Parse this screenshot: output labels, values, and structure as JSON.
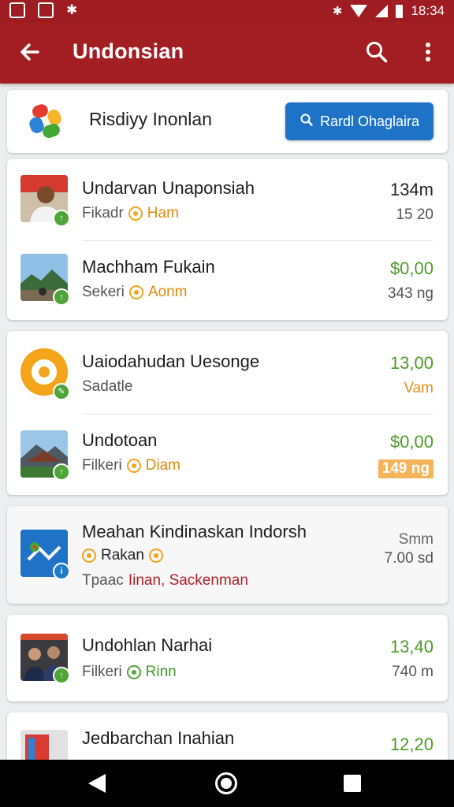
{
  "status_bar": {
    "time": "18:34"
  },
  "app_bar": {
    "title": "Undonsian"
  },
  "header": {
    "title": "Risdiyy Inonlan",
    "button_label": "Rardl Ohaglaira"
  },
  "groups": [
    {
      "items": [
        {
          "name": "Undarvan Unaponsiah",
          "sub_label": "Fikadr",
          "tag": "Ham",
          "amount": "134m",
          "meta": "15 20"
        },
        {
          "name": "Machham Fukain",
          "sub_label": "Sekeri",
          "tag": "Aonm",
          "amount": "$0,00",
          "meta": "343 ng"
        }
      ]
    },
    {
      "items": [
        {
          "name": "Uaiodahudan Uesonge",
          "sub_label": "Sadatle",
          "amount": "13,00",
          "meta": "Vam"
        },
        {
          "name": "Undotoan",
          "sub_label": "Filkeri",
          "tag": "Diam",
          "amount": "$0,00",
          "meta": "149 ng"
        }
      ]
    },
    {
      "items": [
        {
          "name": "Meahan Kindinaskan Indorsh",
          "sub_label": "Rakan",
          "sub_line2_prefix": "Tpaac",
          "sub_line2_link": "Iinan, Sackenman",
          "amount": "Smm",
          "meta": "7.00 sd"
        }
      ]
    },
    {
      "items": [
        {
          "name": "Undohlan Narhai",
          "sub_label": "Filkeri",
          "tag": "Rinn",
          "amount": "13,40",
          "meta": "740 m"
        }
      ]
    },
    {
      "items": [
        {
          "name": "Jedbarchan Inahian",
          "amount": "12,20"
        }
      ]
    }
  ],
  "icons": {
    "back": "arrow-left-icon",
    "search": "search-icon",
    "more": "more-vert-icon",
    "logo": "app-logo-icon",
    "nav_back": "nav-back-icon",
    "nav_home": "nav-home-icon",
    "nav_recent": "nav-recent-icon"
  },
  "colors": {
    "primary": "#a31e23",
    "accent_blue": "#1f73c7",
    "green": "#4d9b27",
    "orange": "#e5901a"
  }
}
